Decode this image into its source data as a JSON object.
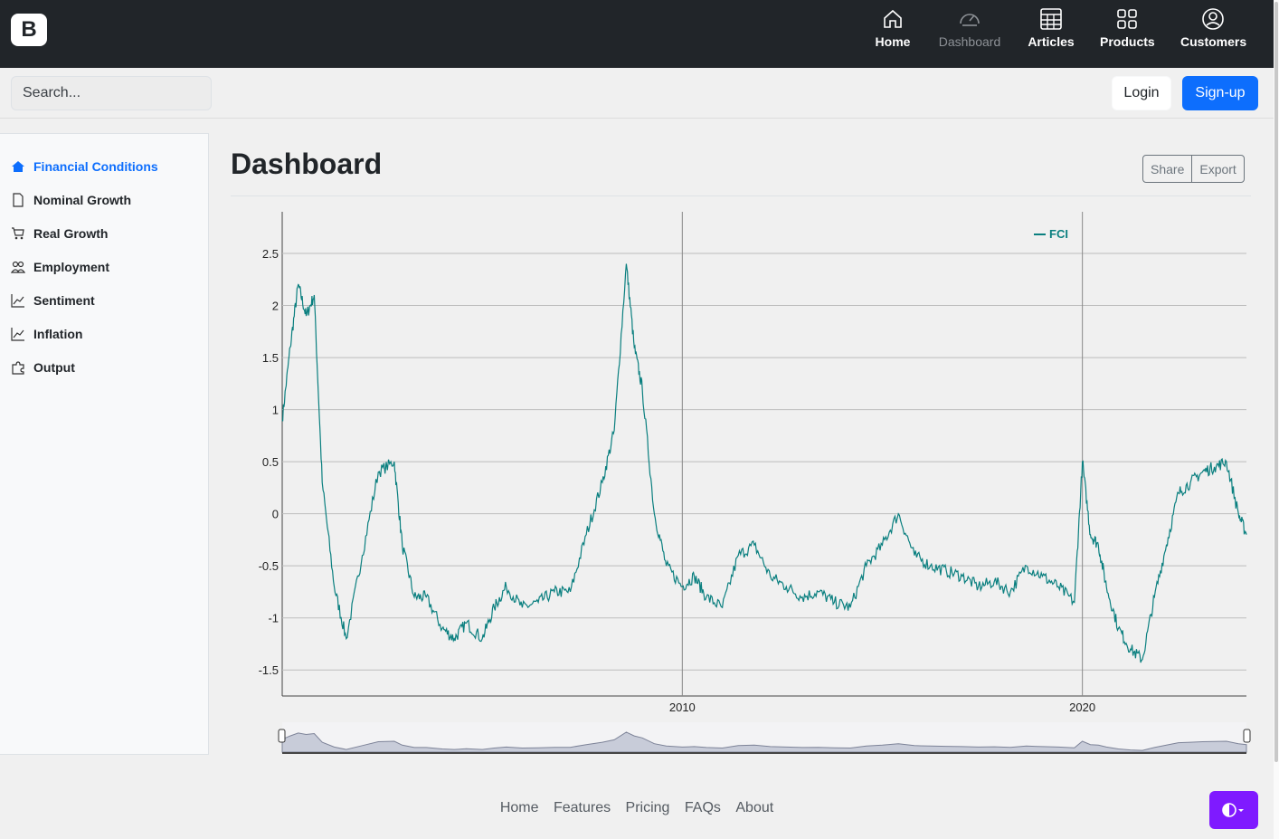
{
  "brand": {
    "letter": "B"
  },
  "topnav": {
    "items": [
      {
        "label": "Home",
        "icon": "home-icon"
      },
      {
        "label": "Dashboard",
        "icon": "speedometer-icon"
      },
      {
        "label": "Articles",
        "icon": "table-icon"
      },
      {
        "label": "Products",
        "icon": "grid-icon"
      },
      {
        "label": "Customers",
        "icon": "person-circle-icon"
      }
    ]
  },
  "search": {
    "placeholder": "Search..."
  },
  "auth": {
    "login": "Login",
    "signup": "Sign-up"
  },
  "sidebar": {
    "items": [
      {
        "label": "Financial Conditions",
        "icon": "house-icon",
        "active": true
      },
      {
        "label": "Nominal Growth",
        "icon": "file-icon"
      },
      {
        "label": "Real Growth",
        "icon": "cart-icon"
      },
      {
        "label": "Employment",
        "icon": "people-icon"
      },
      {
        "label": "Sentiment",
        "icon": "graph-up-icon"
      },
      {
        "label": "Inflation",
        "icon": "graph-up-icon"
      },
      {
        "label": "Output",
        "icon": "puzzle-icon"
      }
    ]
  },
  "main": {
    "title": "Dashboard",
    "share": "Share",
    "export": "Export"
  },
  "chart_data": {
    "type": "line",
    "series": [
      {
        "name": "FCI",
        "color": "#0a7f7f",
        "x": [
          2000.0,
          2000.2,
          2000.4,
          2000.6,
          2000.8,
          2001.0,
          2001.3,
          2001.6,
          2002.0,
          2002.4,
          2002.8,
          2003.0,
          2003.3,
          2003.6,
          2004.0,
          2004.3,
          2004.6,
          2005.0,
          2005.3,
          2005.6,
          2006.0,
          2006.4,
          2006.8,
          2007.2,
          2007.6,
          2008.0,
          2008.3,
          2008.6,
          2008.8,
          2009.0,
          2009.3,
          2009.6,
          2010.0,
          2010.3,
          2010.6,
          2011.0,
          2011.4,
          2011.8,
          2012.2,
          2012.6,
          2013.0,
          2013.4,
          2013.8,
          2014.2,
          2014.6,
          2015.0,
          2015.4,
          2015.8,
          2016.2,
          2016.6,
          2017.0,
          2017.4,
          2017.8,
          2018.2,
          2018.6,
          2019.0,
          2019.4,
          2019.8,
          2020.0,
          2020.2,
          2020.4,
          2020.6,
          2020.9,
          2021.2,
          2021.5,
          2021.8,
          2022.1,
          2022.4,
          2022.7,
          2023.0,
          2023.3,
          2023.6,
          2023.9,
          2024.1
        ],
        "values": [
          0.9,
          1.6,
          2.2,
          1.9,
          2.1,
          0.3,
          -0.7,
          -1.2,
          -0.4,
          0.4,
          0.5,
          -0.3,
          -0.8,
          -0.8,
          -1.1,
          -1.2,
          -1.05,
          -1.2,
          -0.9,
          -0.7,
          -0.9,
          -0.85,
          -0.75,
          -0.75,
          -0.2,
          0.3,
          0.8,
          2.4,
          1.6,
          1.2,
          0.0,
          -0.5,
          -0.7,
          -0.6,
          -0.8,
          -0.9,
          -0.4,
          -0.3,
          -0.6,
          -0.7,
          -0.8,
          -0.75,
          -0.85,
          -0.9,
          -0.5,
          -0.3,
          0.0,
          -0.4,
          -0.5,
          -0.55,
          -0.6,
          -0.7,
          -0.65,
          -0.75,
          -0.5,
          -0.6,
          -0.7,
          -0.85,
          0.5,
          -0.2,
          -0.3,
          -0.7,
          -1.1,
          -1.3,
          -1.4,
          -0.8,
          -0.3,
          0.2,
          0.3,
          0.4,
          0.45,
          0.5,
          0.0,
          -0.2
        ]
      }
    ],
    "x_ticks": [
      "2010",
      "2020"
    ],
    "y_ticks": [
      "2.5",
      "2",
      "1.5",
      "1",
      "0.5",
      "0",
      "-0.5",
      "-1",
      "-1.5"
    ],
    "ylim": [
      -1.75,
      2.9
    ],
    "xlim": [
      2000.0,
      2024.1
    ],
    "grid": true,
    "legend": "top-right",
    "range_selector": true
  },
  "footer": {
    "links": [
      "Home",
      "Features",
      "Pricing",
      "FAQs",
      "About"
    ]
  },
  "theme_button": {
    "icon": "circle-half-icon",
    "color": "#7f1aff"
  }
}
